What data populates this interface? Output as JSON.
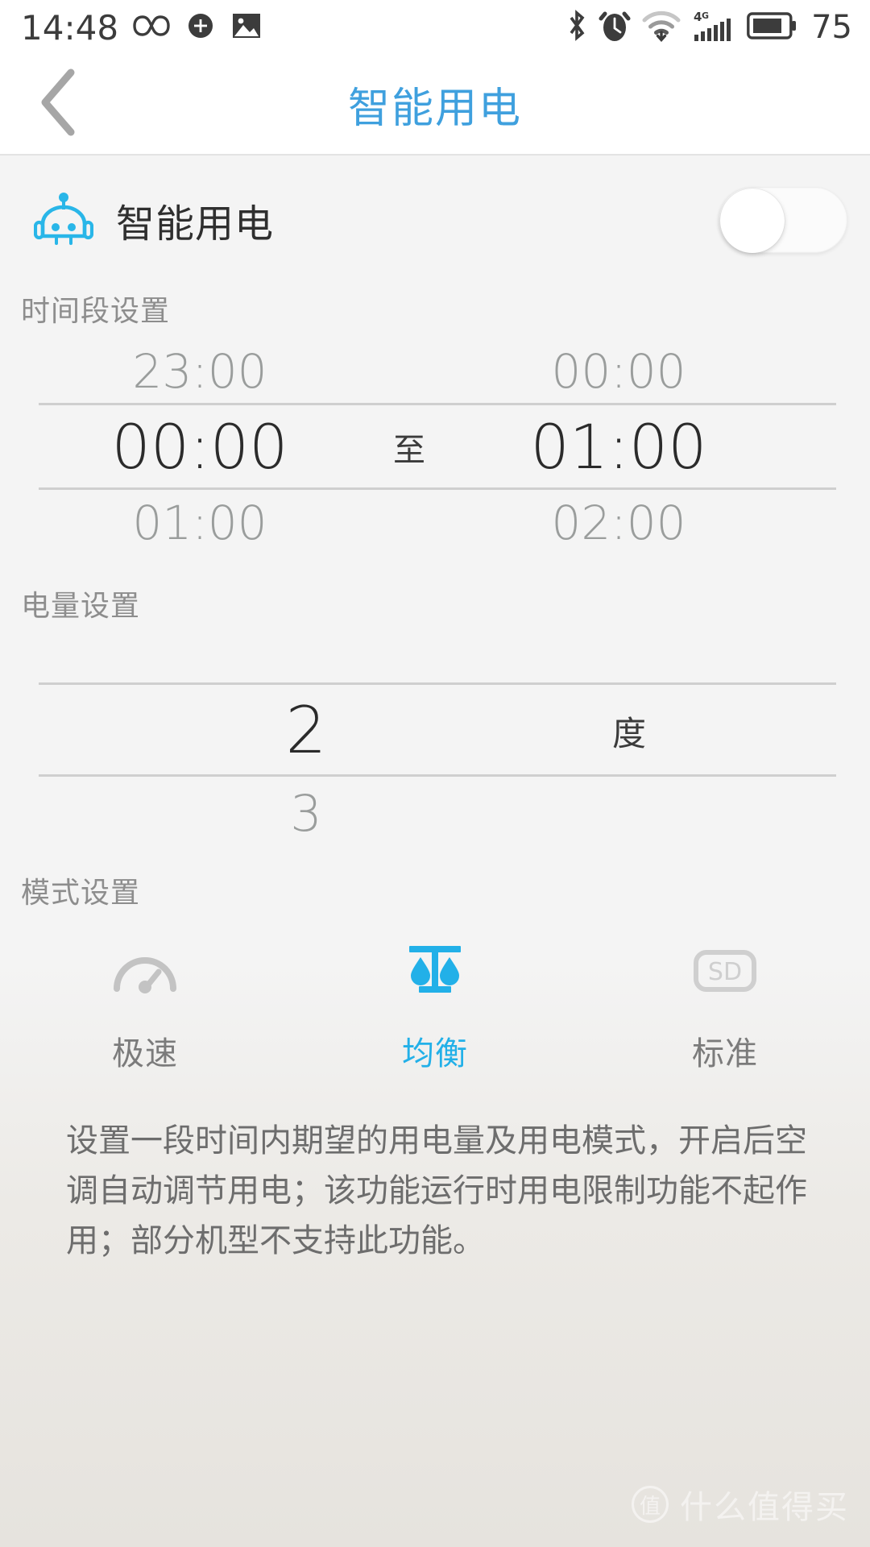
{
  "status_bar": {
    "time": "14:48",
    "battery_percent": "75",
    "left_icons": [
      "infinity-icon",
      "sync-rotate-icon",
      "gallery-image-icon"
    ],
    "right_icons": [
      "bluetooth-icon",
      "alarm-clock-icon",
      "wifi-icon",
      "4g-signal-icon",
      "battery-icon"
    ],
    "network_label": "4G"
  },
  "title_bar": {
    "title": "智能用电",
    "back_icon": "chevron-left-icon",
    "title_color": "#3fa0de"
  },
  "smart_power": {
    "icon": "robot-head-icon",
    "label": "智能用电",
    "toggle_state": "off"
  },
  "time_section": {
    "label": "时间段设置",
    "separator": "至",
    "rows": [
      {
        "start": "23:00",
        "end": "00:00",
        "state": "dim"
      },
      {
        "start": "00:00",
        "end": "01:00",
        "state": "selected"
      },
      {
        "start": "01:00",
        "end": "02:00",
        "state": "dim"
      }
    ]
  },
  "power_section": {
    "label": "电量设置",
    "unit": "度",
    "rows": [
      {
        "value": "2",
        "state": "selected"
      },
      {
        "value": "3",
        "state": "dim"
      }
    ]
  },
  "mode_section": {
    "label": "模式设置",
    "items": [
      {
        "label": "极速",
        "icon": "speedometer-icon",
        "selected": false
      },
      {
        "label": "均衡",
        "icon": "balance-scale-icon",
        "selected": true
      },
      {
        "label": "标准",
        "icon": "sd-badge-icon",
        "selected": false
      }
    ],
    "accent_color": "#22b0e8"
  },
  "description": {
    "text": "设置一段时间内期望的用电量及用电模式，开启后空调自动调节用电；该功能运行时用电限制功能不起作用；部分机型不支持此功能。"
  },
  "watermark": {
    "logo_text": "值",
    "text": "什么值得买"
  }
}
